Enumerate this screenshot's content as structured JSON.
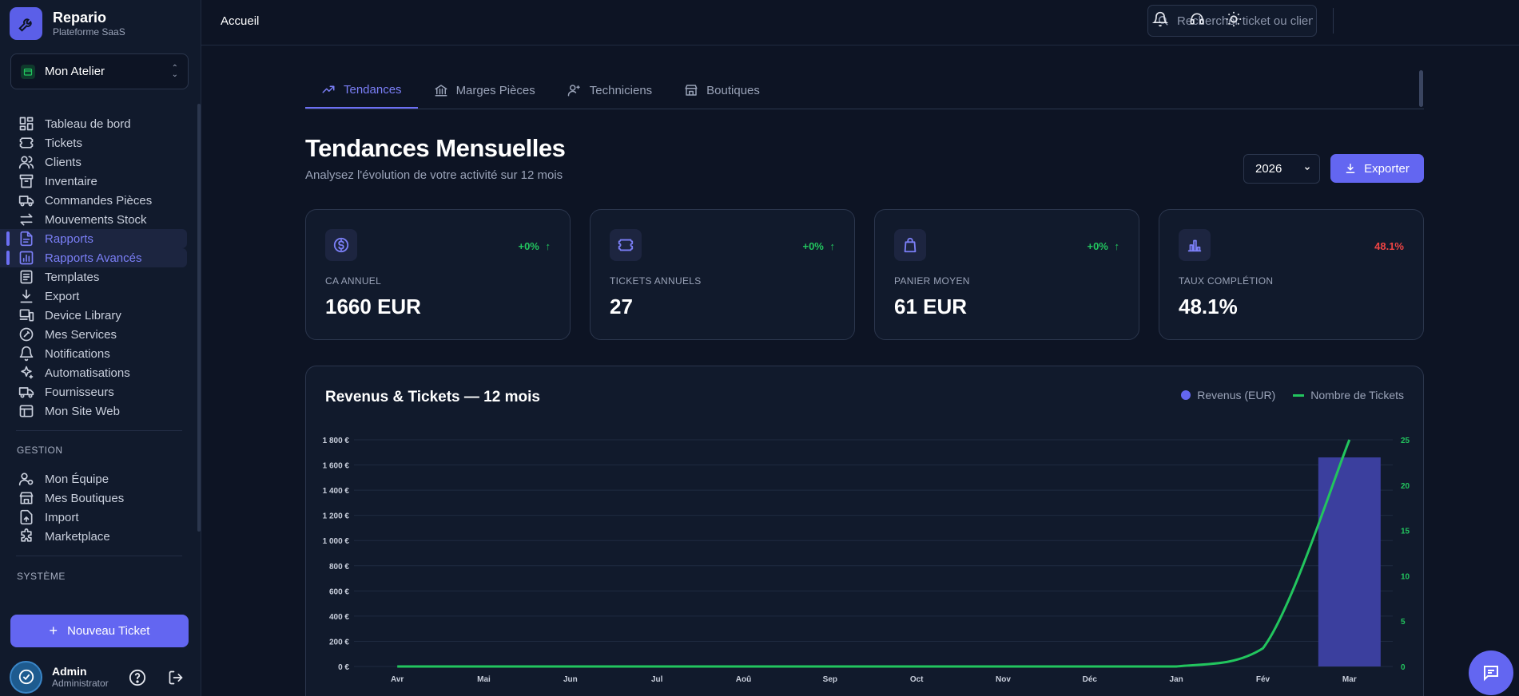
{
  "brand": {
    "name": "Repario",
    "subtitle": "Plateforme SaaS"
  },
  "workspace": {
    "label": "Mon Atelier"
  },
  "nav": {
    "items": [
      {
        "label": "Tableau de bord",
        "icon": "dashboard-icon"
      },
      {
        "label": "Tickets",
        "icon": "ticket-icon"
      },
      {
        "label": "Clients",
        "icon": "users-icon"
      },
      {
        "label": "Inventaire",
        "icon": "archive-icon"
      },
      {
        "label": "Commandes Pièces",
        "icon": "truck-icon"
      },
      {
        "label": "Mouvements Stock",
        "icon": "arrows-icon"
      },
      {
        "label": "Rapports",
        "icon": "file-icon",
        "active": true
      },
      {
        "label": "Rapports Avancés",
        "icon": "chart-icon",
        "active": true
      },
      {
        "label": "Templates",
        "icon": "template-icon"
      },
      {
        "label": "Export",
        "icon": "download-icon"
      },
      {
        "label": "Device Library",
        "icon": "devices-icon"
      },
      {
        "label": "Mes Services",
        "icon": "wrench-icon"
      },
      {
        "label": "Notifications",
        "icon": "bell-icon"
      },
      {
        "label": "Automatisations",
        "icon": "sparkles-icon"
      },
      {
        "label": "Fournisseurs",
        "icon": "truck-icon"
      },
      {
        "label": "Mon Site Web",
        "icon": "website-icon"
      }
    ],
    "gestion_label": "GESTION",
    "gestion": [
      {
        "label": "Mon Équipe",
        "icon": "user-cog-icon"
      },
      {
        "label": "Mes Boutiques",
        "icon": "store-icon"
      },
      {
        "label": "Import",
        "icon": "upload-icon"
      },
      {
        "label": "Marketplace",
        "icon": "puzzle-icon"
      }
    ],
    "systeme_label": "SYSTÈME"
  },
  "new_ticket_label": "Nouveau Ticket",
  "user": {
    "name": "Admin",
    "role": "Administrator"
  },
  "header": {
    "breadcrumb": "Accueil",
    "search_placeholder": "Rechercher ticket ou client..."
  },
  "tabs": [
    {
      "label": "Tendances",
      "icon": "trend-icon",
      "active": true
    },
    {
      "label": "Marges Pièces",
      "icon": "bank-icon"
    },
    {
      "label": "Techniciens",
      "icon": "user-gear-icon"
    },
    {
      "label": "Boutiques",
      "icon": "store-icon"
    }
  ],
  "page": {
    "title": "Tendances Mensuelles",
    "subtitle": "Analysez l'évolution de votre activité sur 12 mois",
    "year": "2026",
    "export_label": "Exporter"
  },
  "kpis": [
    {
      "label": "CA ANNUEL",
      "value": "1660 EUR",
      "trend": "+0%",
      "trend_color": "#22c55e",
      "icon": "dollar-icon",
      "arrow": "↑"
    },
    {
      "label": "TICKETS ANNUELS",
      "value": "27",
      "trend": "+0%",
      "trend_color": "#22c55e",
      "icon": "ticket-icon",
      "arrow": "↑"
    },
    {
      "label": "PANIER MOYEN",
      "value": "61 EUR",
      "trend": "+0%",
      "trend_color": "#22c55e",
      "icon": "bag-icon",
      "arrow": "↑"
    },
    {
      "label": "TAUX COMPLÉTION",
      "value": "48.1%",
      "trend": "48.1%",
      "trend_color": "#ef4444",
      "icon": "bar-chart-icon",
      "arrow": ""
    }
  ],
  "colors": {
    "accent": "#6366f1",
    "positive": "#22c55e",
    "negative": "#ef4444",
    "bg": "#0d1424",
    "card": "#111a2c"
  },
  "chart_data": {
    "type": "bar",
    "title": "Revenus & Tickets — 12 mois",
    "categories": [
      "Avr",
      "Mai",
      "Jun",
      "Jul",
      "Aoû",
      "Sep",
      "Oct",
      "Nov",
      "Déc",
      "Jan",
      "Fév",
      "Mar"
    ],
    "series": [
      {
        "name": "Revenus (EUR)",
        "type": "bar",
        "axis": "left",
        "color": "#3b3f9e",
        "values": [
          0,
          0,
          0,
          0,
          0,
          0,
          0,
          0,
          0,
          0,
          0,
          1660
        ]
      },
      {
        "name": "Nombre de Tickets",
        "type": "line",
        "axis": "right",
        "color": "#22c55e",
        "values": [
          0,
          0,
          0,
          0,
          0,
          0,
          0,
          0,
          0,
          0,
          2,
          25
        ]
      }
    ],
    "y_left": {
      "min": 0,
      "max": 1800,
      "ticks": [
        "0 €",
        "200 €",
        "400 €",
        "600 €",
        "800 €",
        "1 000 €",
        "1 200 €",
        "1 400 €",
        "1 600 €",
        "1 800 €"
      ]
    },
    "y_right": {
      "min": 0,
      "max": 25,
      "ticks": [
        "0",
        "5",
        "10",
        "15",
        "20",
        "25"
      ]
    },
    "grid": true,
    "legend": "top-right"
  }
}
